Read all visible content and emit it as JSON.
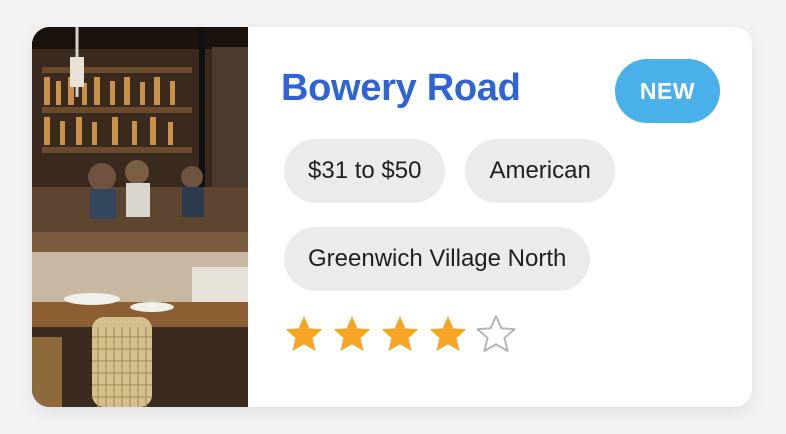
{
  "restaurant": {
    "name": "Bowery Road",
    "badge": "NEW",
    "tags": [
      "$31 to $50",
      "American",
      "Greenwich Village North"
    ],
    "rating": 4,
    "rating_max": 5,
    "photo_icon": "restaurant-interior-photo"
  },
  "colors": {
    "title": "#2f63d6",
    "badge_bg": "#4ab0ea",
    "badge_text": "#ffffff",
    "tag_bg": "#ebebeb",
    "star_filled": "#f5a623",
    "star_empty": "#b5b5b5"
  }
}
